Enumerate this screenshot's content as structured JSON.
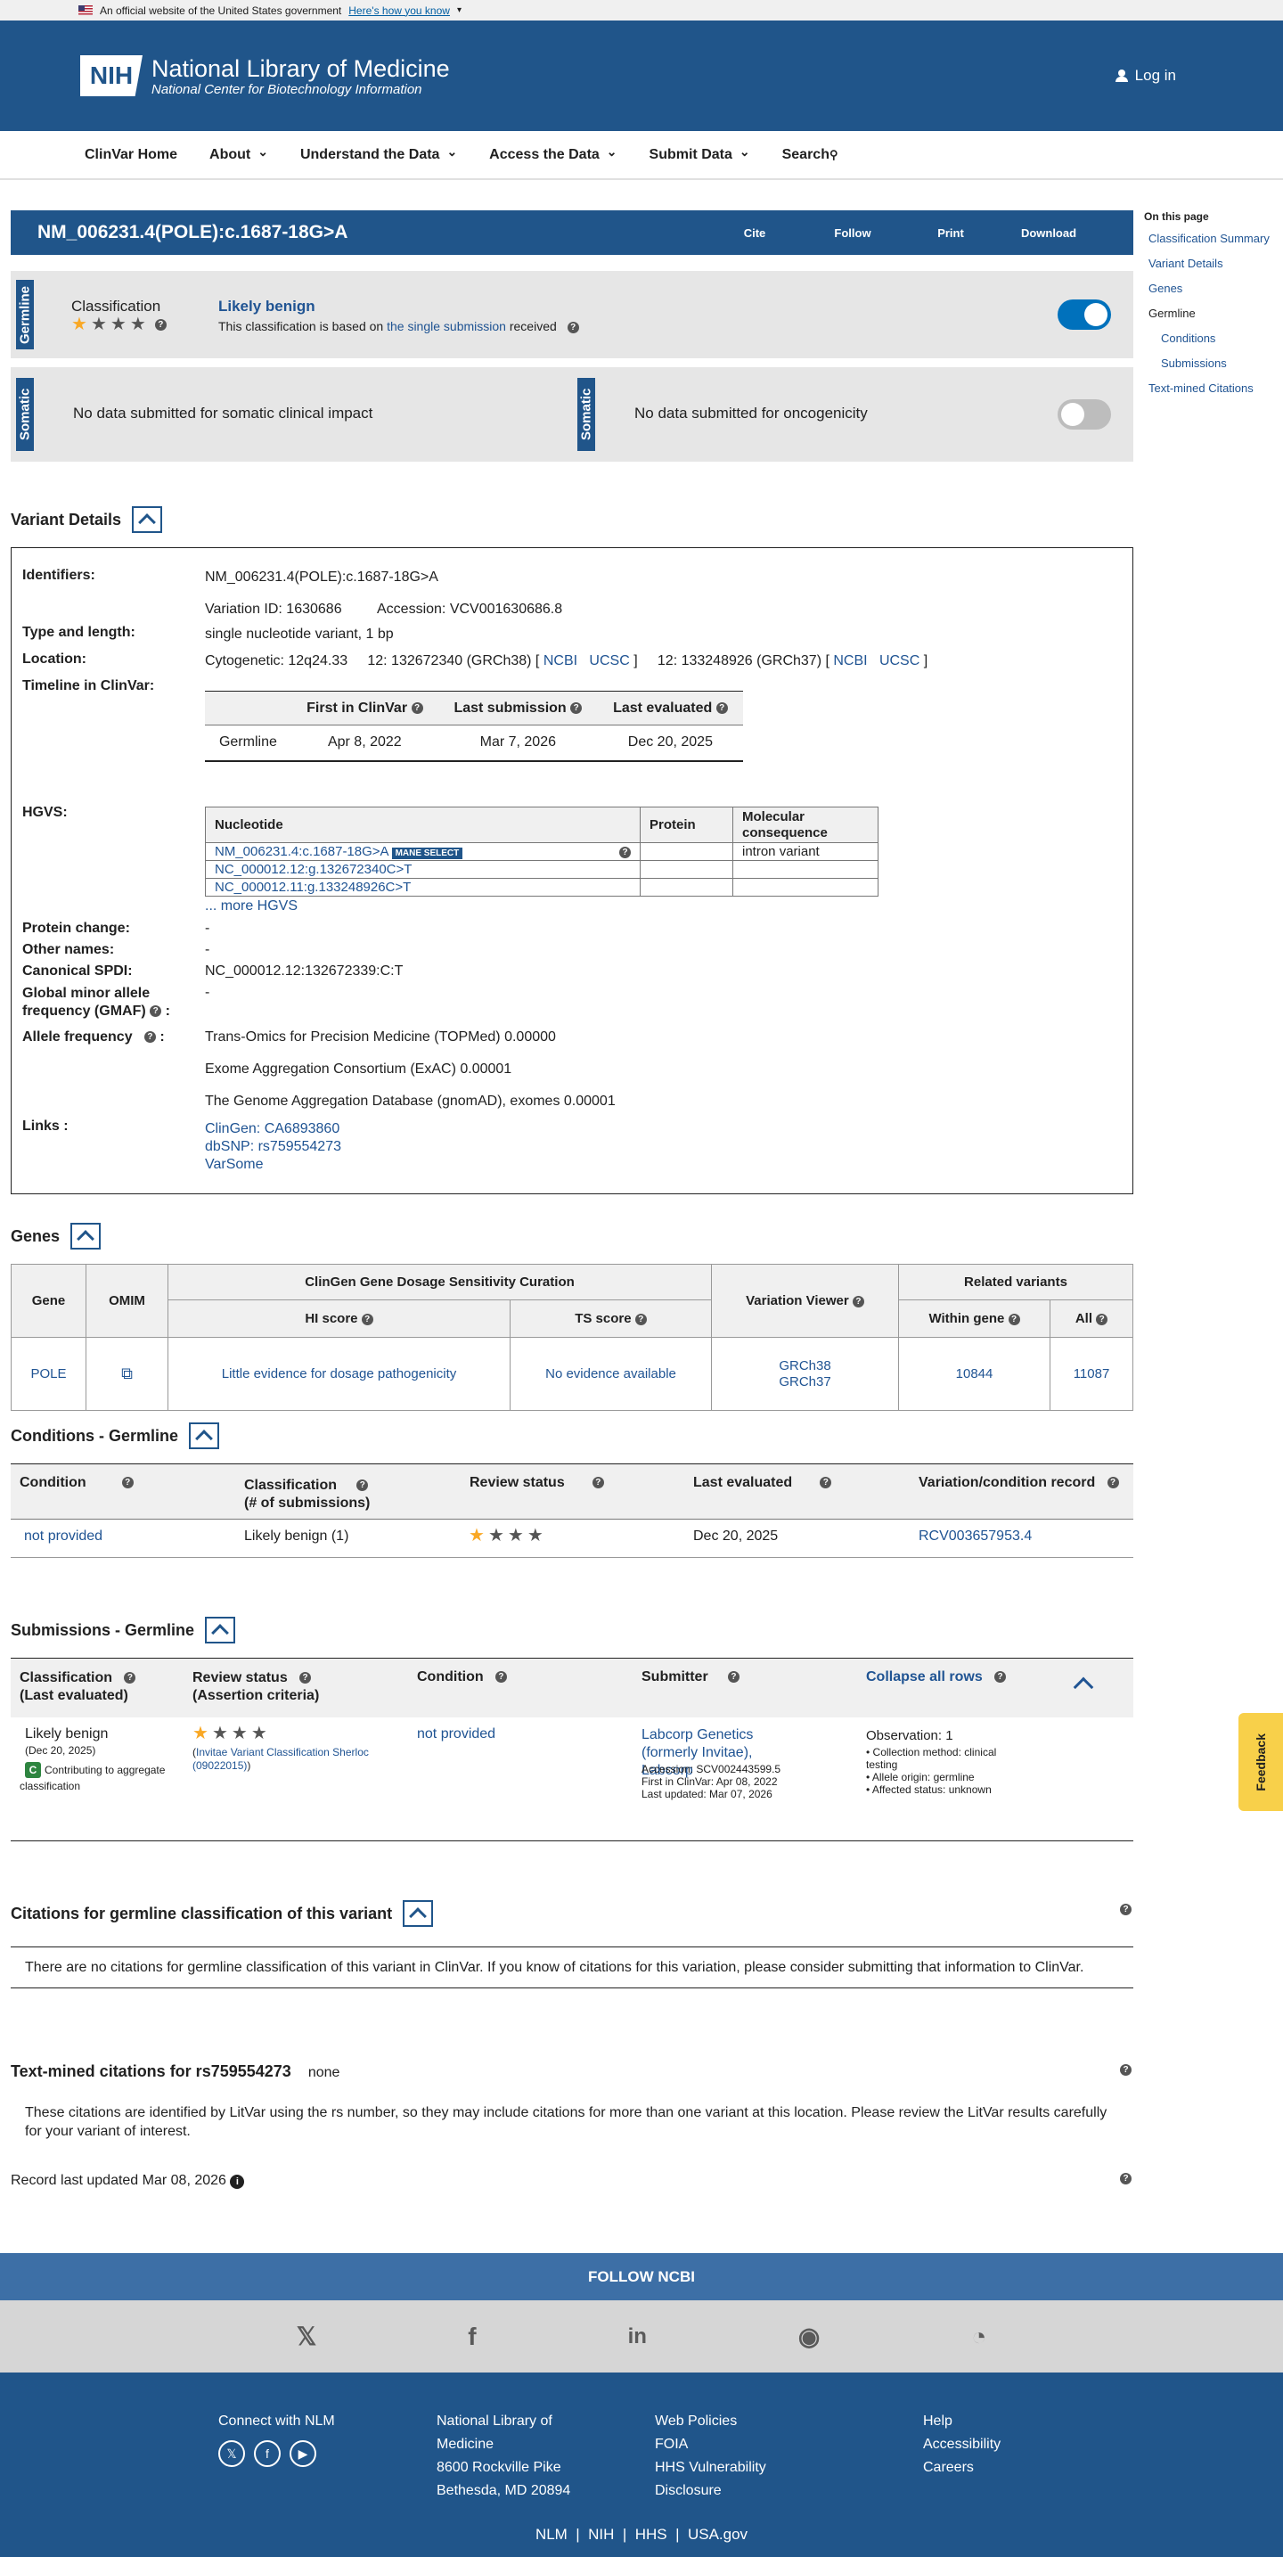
{
  "gov_banner": {
    "text": "An official website of the United States government",
    "link": "Here's how you know"
  },
  "header": {
    "logo": "NIH",
    "title": "National Library of Medicine",
    "subtitle": "National Center for Biotechnology Information",
    "login": "Log in"
  },
  "nav": [
    "ClinVar Home",
    "About",
    "Understand the Data",
    "Access the Data",
    "Submit Data",
    "Search"
  ],
  "title": "NM_006231.4(POLE):c.1687-18G>A",
  "title_actions": [
    "Cite",
    "Follow",
    "Print",
    "Download"
  ],
  "toc": {
    "heading": "On this page",
    "items": [
      "Classification Summary",
      "Variant Details",
      "Genes",
      "Germline",
      "Conditions",
      "Submissions",
      "Text-mined Citations"
    ]
  },
  "germline": {
    "tab": "Germline",
    "label": "Classification",
    "classification": "Likely benign",
    "basis_pre": "This classification is based on ",
    "basis_link": "the single submission",
    "basis_post": " received"
  },
  "somatic": {
    "tab": "Somatic",
    "clinical": "No data submitted for somatic clinical impact",
    "onco": "No data submitted for oncogenicity"
  },
  "variant_details": {
    "heading": "Variant Details",
    "labels": {
      "identifiers": "Identifiers:",
      "type": "Type and length:",
      "location": "Location:",
      "timeline": "Timeline in ClinVar:",
      "hgvs": "HGVS:",
      "protein": "Protein change:",
      "other": "Other names:",
      "spdi": "Canonical SPDI:",
      "gmaf": "Global minor allele frequency (GMAF)",
      "allele": "Allele frequency",
      "links": "Links :"
    },
    "identifier": "NM_006231.4(POLE):c.1687-18G>A",
    "variation_id": "Variation ID: 1630686",
    "accession": "Accession: VCV001630686.8",
    "type": "single nucleotide variant, 1 bp",
    "cyto": "Cytogenetic: 12q24.33",
    "loc38": "12: 132672340 (GRCh38) [",
    "loc37": "12: 133248926 (GRCh37) [",
    "ncbi": "NCBI",
    "ucsc": "UCSC",
    "close": "]",
    "timeline_headers": [
      "First in ClinVar",
      "Last submission",
      "Last evaluated"
    ],
    "timeline_row": [
      "Germline",
      "Apr 8, 2022",
      "Mar 7, 2026",
      "Dec 20, 2025"
    ],
    "hgvs_headers": [
      "Nucleotide",
      "Protein",
      "Molecular consequence"
    ],
    "hgvs_rows": [
      {
        "nuc": "NM_006231.4:c.1687-18G>A",
        "mane": "MANE SELECT",
        "cons": "intron variant"
      },
      {
        "nuc": "NC_000012.12:g.132672340C>T",
        "cons": ""
      },
      {
        "nuc": "NC_000012.11:g.133248926C>T",
        "cons": ""
      }
    ],
    "more_hgvs": "... more HGVS",
    "protein_change": "-",
    "other_names": "-",
    "spdi": "NC_000012.12:132672339:C:T",
    "gmaf": "-",
    "freqs": [
      "Trans-Omics for Precision Medicine (TOPMed) 0.00000",
      "Exome Aggregation Consortium (ExAC) 0.00001",
      "The Genome Aggregation Database (gnomAD), exomes 0.00001"
    ],
    "links": [
      "ClinGen: CA6893860",
      "dbSNP: rs759554273",
      "VarSome"
    ]
  },
  "genes": {
    "heading": "Genes",
    "h": {
      "gene": "Gene",
      "omim": "OMIM",
      "clingen": "ClinGen Gene Dosage Sensitivity Curation",
      "hi": "HI score",
      "ts": "TS score",
      "viewer": "Variation Viewer",
      "related": "Related variants",
      "within": "Within gene",
      "all": "All"
    },
    "row": {
      "gene": "POLE",
      "hi": "Little evidence for dosage pathogenicity",
      "ts": "No evidence available",
      "grch38": "GRCh38",
      "grch37": "GRCh37",
      "within": "10844",
      "all": "11087"
    }
  },
  "conditions": {
    "heading": "Conditions - Germline",
    "headers": [
      "Condition",
      "Classification",
      "(# of submissions)",
      "Review status",
      "Last evaluated",
      "Variation/condition record"
    ],
    "row": {
      "condition": "not provided",
      "classification": "Likely benign (1)",
      "last": "Dec 20, 2025",
      "record": "RCV003657953.4"
    }
  },
  "submissions": {
    "heading": "Submissions - Germline",
    "headers": {
      "class": "Classification",
      "class2": "(Last evaluated)",
      "review": "Review status",
      "review2": "(Assertion criteria)",
      "cond": "Condition",
      "sub": "Submitter",
      "collapse": "Collapse all rows"
    },
    "row": {
      "class": "Likely benign",
      "date": "(Dec 20, 2025)",
      "contrib": "Contributing to aggregate classification",
      "criteria": "Invitae Variant Classification Sherloc (09022015)",
      "condition": "not provided",
      "submitter": "Labcorp Genetics (formerly Invitae), Labcorp",
      "acc": "Accession: SCV002443599.5",
      "first": "First in ClinVar: Apr 08, 2022",
      "updated": "Last updated: Mar 07, 2026",
      "obs": "Observation: 1",
      "bullets": [
        "Collection method: clinical testing",
        "Allele origin: germline",
        "Affected status: unknown"
      ]
    }
  },
  "citations": {
    "heading": "Citations for germline classification of this variant",
    "text": "There are no citations for germline classification of this variant in ClinVar. If you know of citations for this variation, please consider submitting that information to ClinVar."
  },
  "textmined": {
    "heading": "Text-mined citations for rs759554273",
    "none": "none",
    "text": "These citations are identified by LitVar using the rs number, so they may include citations for more than one variant at this location. Please review the LitVar results carefully for your variant of interest."
  },
  "record_updated": "Record last updated Mar 08, 2026",
  "feedback": "Feedback",
  "footer": {
    "follow": "FOLLOW NCBI",
    "connect": "Connect with NLM",
    "nlm": [
      "National Library of",
      "Medicine",
      "8600 Rockville Pike",
      "Bethesda, MD 20894"
    ],
    "col3": [
      "Web Policies",
      "FOIA",
      "HHS Vulnerability",
      "Disclosure"
    ],
    "col4": [
      "Help",
      "Accessibility",
      "Careers"
    ],
    "bottom": [
      "NLM",
      "NIH",
      "HHS",
      "USA.gov"
    ]
  },
  "colors": {
    "primary": "#20558a",
    "star": "#f9a825",
    "toggle_on": "#0071bc",
    "toggle_off": "#bdbdbd"
  }
}
